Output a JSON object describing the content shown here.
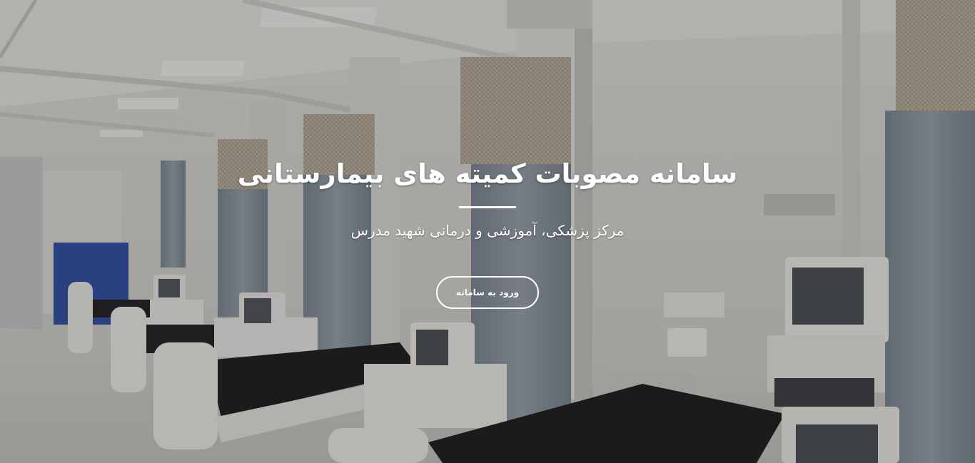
{
  "hero": {
    "title": "سامانه مصوبات کمیته های بیمارستانی",
    "subtitle": "مرکز پزشکی، آموزشی و درمانی شهید مدرس",
    "button_label": "ورود به سامانه"
  },
  "colors": {
    "text": "#ffffff",
    "overlay": "rgba(30,30,30,0.28)",
    "bed_mattress": "#1e1e1e",
    "curtain": "#8c96a3",
    "wall": "#dcdad4"
  },
  "background": {
    "scene": "hospital-ward-photo"
  }
}
